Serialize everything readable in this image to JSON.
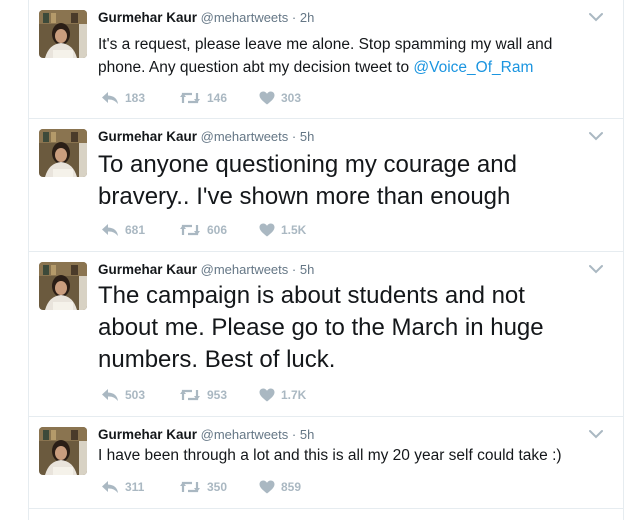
{
  "tweets": [
    {
      "name": "Gurmehar Kaur",
      "handle": "@mehartweets",
      "separator": "·",
      "time": "2h",
      "text_lines": [
        "It's a request, please leave me alone. Stop spamming my wall and",
        "phone. Any question abt my decision tweet to "
      ],
      "mention": "@Voice_Of_Ram",
      "replies": "183",
      "retweets": "146",
      "likes": "303"
    },
    {
      "name": "Gurmehar Kaur",
      "handle": "@mehartweets",
      "separator": "·",
      "time": "5h",
      "text_lines": [
        "To anyone questioning my courage and",
        "bravery.. I've shown more than enough"
      ],
      "replies": "681",
      "retweets": "606",
      "likes": "1.5K"
    },
    {
      "name": "Gurmehar Kaur",
      "handle": "@mehartweets",
      "separator": "·",
      "time": "5h",
      "text_lines": [
        "The campaign is about students and not",
        "about me. Please go to the March in huge",
        "numbers. Best of luck."
      ],
      "replies": "503",
      "retweets": "953",
      "likes": "1.7K"
    },
    {
      "name": "Gurmehar Kaur",
      "handle": "@mehartweets",
      "separator": "·",
      "time": "5h",
      "text_lines": [
        "I have been through a lot and this is all my 20 year self could take :)"
      ],
      "replies": "311",
      "retweets": "350",
      "likes": "859"
    }
  ],
  "colors": {
    "name": "#14171a",
    "meta": "#657786",
    "mention": "#1b95e0",
    "action": "#aab8c2",
    "border": "#e6ecf0"
  },
  "icons": [
    "reply-icon",
    "retweet-icon",
    "like-icon",
    "chevron-down-icon"
  ]
}
